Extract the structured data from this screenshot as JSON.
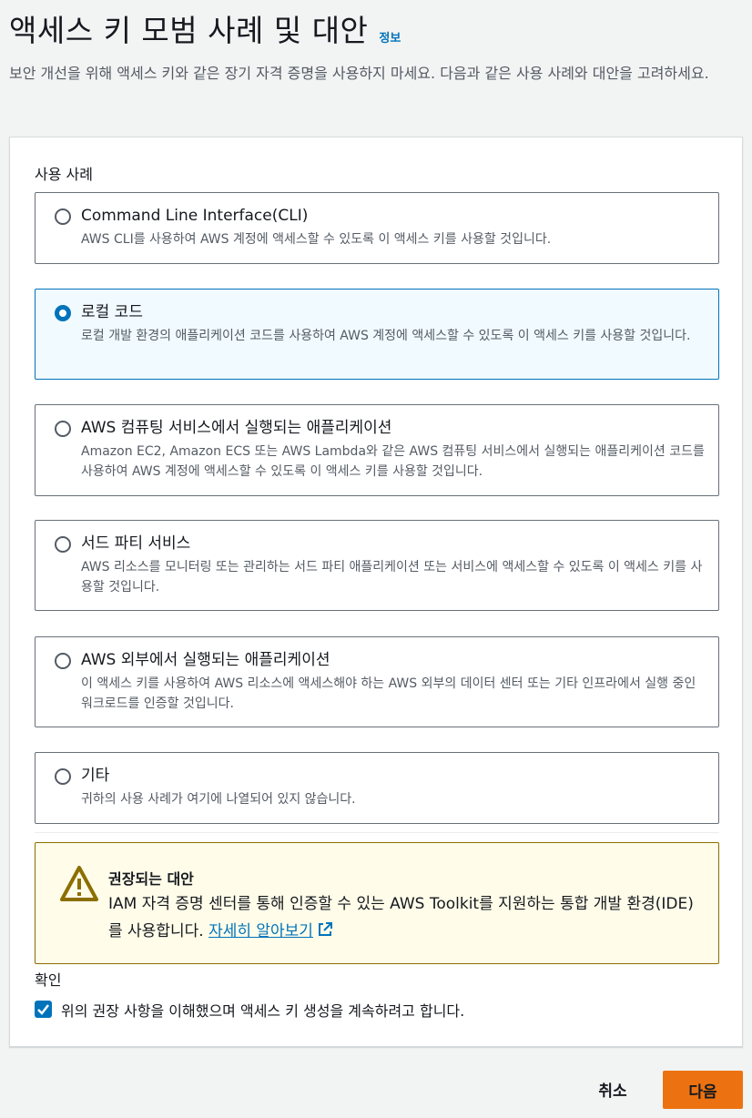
{
  "header": {
    "title": "액세스 키 모범 사례 및 대안",
    "info_link": "정보",
    "description": "보안 개선을 위해 액세스 키와 같은 장기 자격 증명을 사용하지 마세요. 다음과 같은 사용 사례와 대안을 고려하세요."
  },
  "use_cases": {
    "label": "사용 사례",
    "options": [
      {
        "title": "Command Line Interface(CLI)",
        "description": "AWS CLI를 사용하여 AWS 계정에 액세스할 수 있도록 이 액세스 키를 사용할 것입니다.",
        "selected": false
      },
      {
        "title": "로컬 코드",
        "description": "로컬 개발 환경의 애플리케이션 코드를 사용하여 AWS 계정에 액세스할 수 있도록 이 액세스 키를 사용할 것입니다.",
        "selected": true
      },
      {
        "title": "AWS 컴퓨팅 서비스에서 실행되는 애플리케이션",
        "description": "Amazon EC2, Amazon ECS 또는 AWS Lambda와 같은 AWS 컴퓨팅 서비스에서 실행되는 애플리케이션 코드를 사용하여 AWS 계정에 액세스할 수 있도록 이 액세스 키를 사용할 것입니다.",
        "selected": false
      },
      {
        "title": "서드 파티 서비스",
        "description": "AWS 리소스를 모니터링 또는 관리하는 서드 파티 애플리케이션 또는 서비스에 액세스할 수 있도록 이 액세스 키를 사용할 것입니다.",
        "selected": false
      },
      {
        "title": "AWS 외부에서 실행되는 애플리케이션",
        "description": "이 액세스 키를 사용하여 AWS 리소스에 액세스해야 하는 AWS 외부의 데이터 센터 또는 기타 인프라에서 실행 중인 워크로드를 인증할 것입니다.",
        "selected": false
      },
      {
        "title": "기타",
        "description": "귀하의 사용 사례가 여기에 나열되어 있지 않습니다.",
        "selected": false
      }
    ]
  },
  "alert": {
    "title": "권장되는 대안",
    "body": "IAM 자격 증명 센터를 통해 인증할 수 있는 AWS Toolkit를 지원하는 통합 개발 환경(IDE)를 사용합니다.",
    "link": "자세히 알아보기",
    "icon": "warning-icon",
    "color": "#8c6e00"
  },
  "confirmation": {
    "label": "확인",
    "checkbox_text": "위의 권장 사항을 이해했으며 액세스 키 생성을 계속하려고 합니다.",
    "checked": true
  },
  "footer": {
    "cancel_label": "취소",
    "next_label": "다음"
  },
  "colors": {
    "accent": "#0073bb",
    "primary_button": "#ec7211",
    "selected_bg": "#f1faff"
  }
}
